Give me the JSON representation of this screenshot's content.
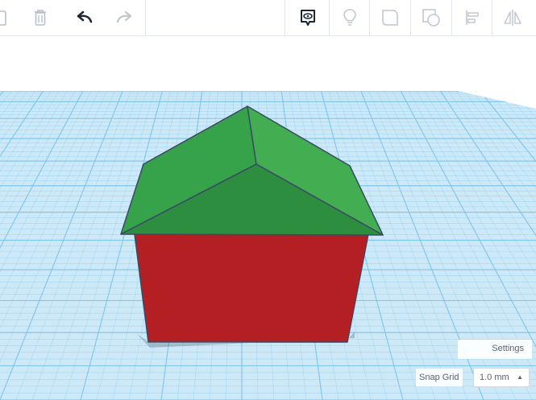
{
  "toolbar": {
    "icons": [
      "paste-icon",
      "delete-icon",
      "undo-icon",
      "redo-icon",
      "notes-icon",
      "light-bulb-icon",
      "solid-shape-icon",
      "hole-shape-icon",
      "align-icon",
      "mirror-icon"
    ]
  },
  "workplane": {
    "grid_color": "#cde9f7",
    "grid_line_color": "#7fc6ec",
    "shapes": [
      {
        "name": "box",
        "color": "#b41f24"
      },
      {
        "name": "roof",
        "color": "#2f9e44"
      }
    ]
  },
  "controls": {
    "settings_label": "Settings",
    "snap_grid_label": "Snap Grid",
    "snap_grid_value": "1.0 mm",
    "snap_grid_caret": "▲"
  }
}
